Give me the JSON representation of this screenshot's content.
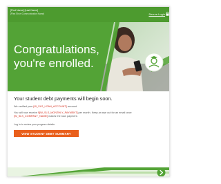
{
  "header": {
    "sender_name": "[First Name] [Last Name]",
    "sender_sub": "[Plan Short Communication Name]",
    "secure_login": "Secure Login",
    "lock_icon": "lock-icon"
  },
  "hero": {
    "title_line1": "Congratulations,",
    "title_line2": "you're enrolled.",
    "photo": "person-with-phone-photo",
    "overlay_icon": "person-graduation-icon"
  },
  "content": {
    "headline": "Your student debt payments will begin soon.",
    "verified_prefix": "We verified your ",
    "verified_token": "[W_SLS_LOAN_ACCOUNT]",
    "verified_suffix": " account.",
    "para_a": "You will now receive ",
    "para_token1": "$[W_SLS_MONTHLY_PAYMENT]",
    "para_b": " per month. Keep an eye out for an email once ",
    "para_token2": "[W_SLS_COMPANY_NAME]",
    "para_c": " makes the loan payment.",
    "login_hint": "Log in to review your program details.",
    "cta_label": "VIEW STUDENT DEBT SUMMARY"
  },
  "footer": {
    "next_icon": "chevron-right-icon"
  },
  "colors": {
    "brand_green": "#53a336",
    "bar_green": "#4d9b2f",
    "cta_orange": "#e95f1c",
    "merge_red": "#d4301f"
  }
}
